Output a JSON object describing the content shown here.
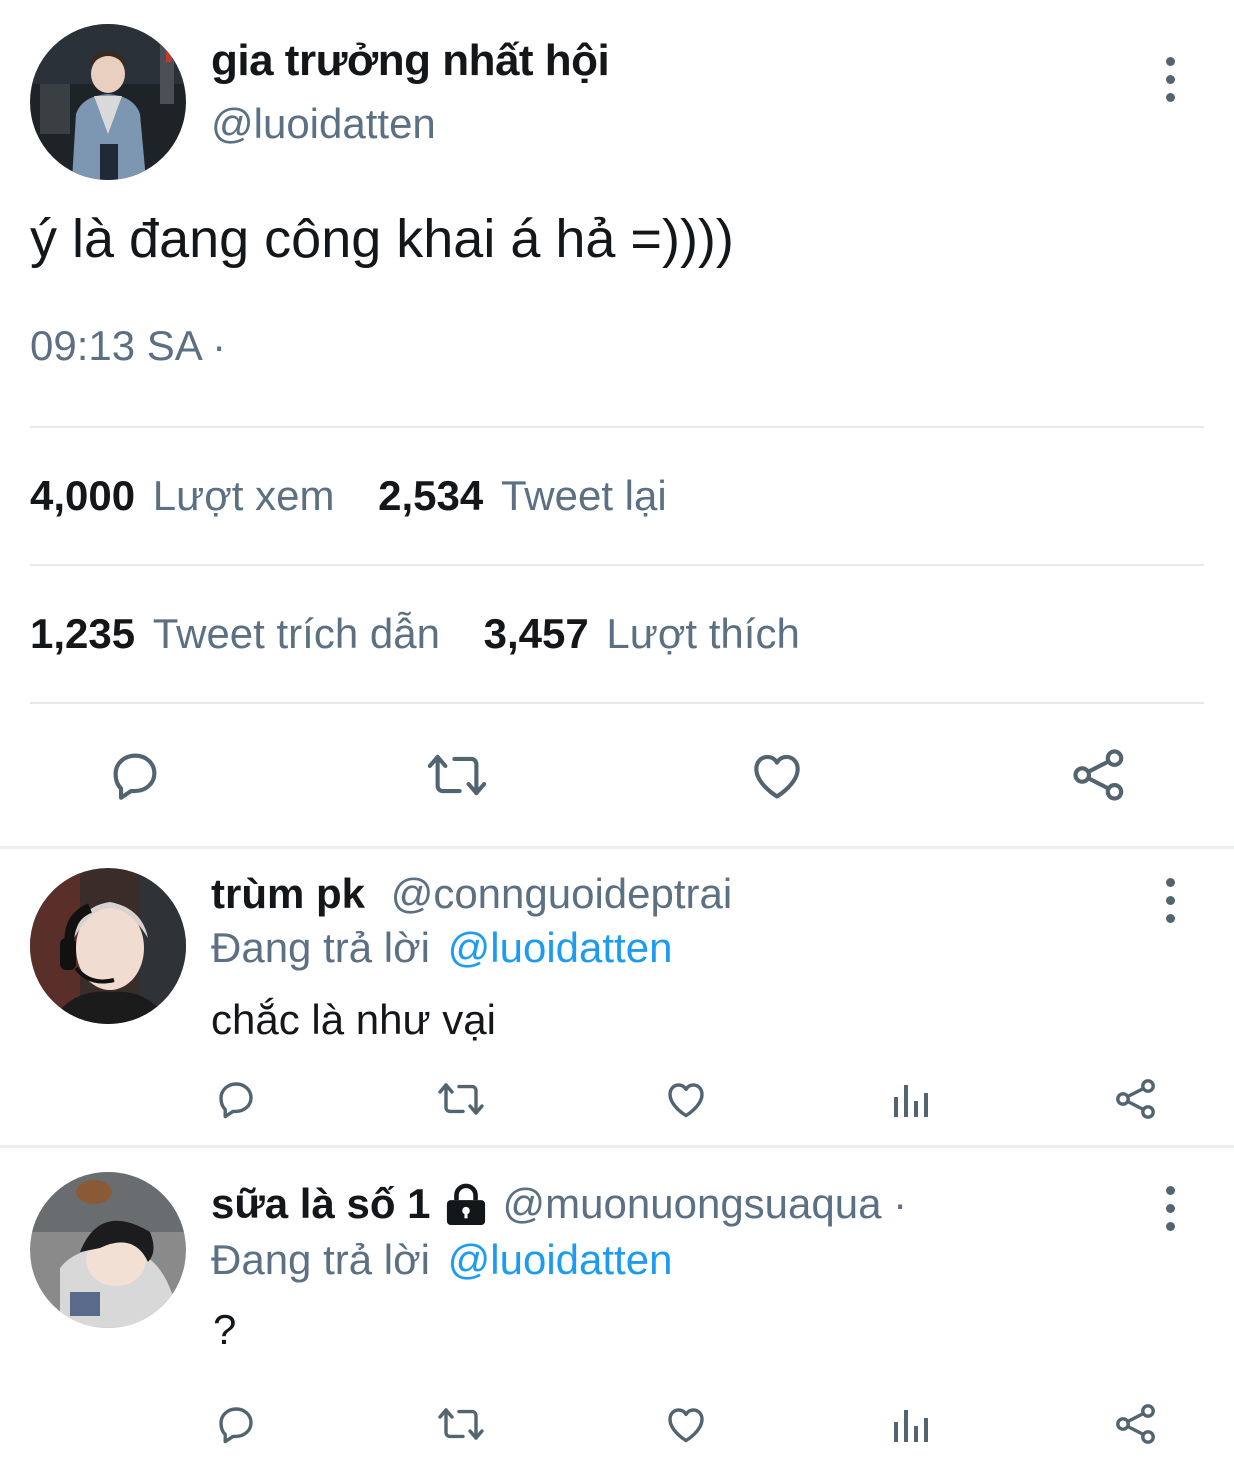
{
  "tweet": {
    "display_name": "gia trưởng nhất hội",
    "handle": "@luoidatten",
    "text": "ý là đang công khai á hả =))))",
    "time": "09:13 SA ·",
    "stats": {
      "views_count": "4,000",
      "views_label": "Lượt xem",
      "retweets_count": "2,534",
      "retweets_label": "Tweet lại",
      "quotes_count": "1,235",
      "quotes_label": "Tweet trích dẫn",
      "likes_count": "3,457",
      "likes_label": "Lượt thích"
    },
    "actions": [
      "reply-icon",
      "retweet-icon",
      "like-icon",
      "share-icon"
    ]
  },
  "replies": [
    {
      "display_name": "trùm pk",
      "handle": "@connguoideptrai",
      "replying_prefix": "Đang trả lời",
      "replying_to": "@luoidatten",
      "text": "chắc là như vại",
      "locked": false
    },
    {
      "display_name": "sữa là số 1",
      "handle": "@muonuongsuaqua ·",
      "replying_prefix": "Đang trả lời",
      "replying_to": "@luoidatten",
      "text": "?",
      "locked": true
    }
  ],
  "colors": {
    "text": "#14171a",
    "secondary": "#5b7083",
    "link": "#1d9bf0",
    "divider": "#e6e9ec"
  }
}
